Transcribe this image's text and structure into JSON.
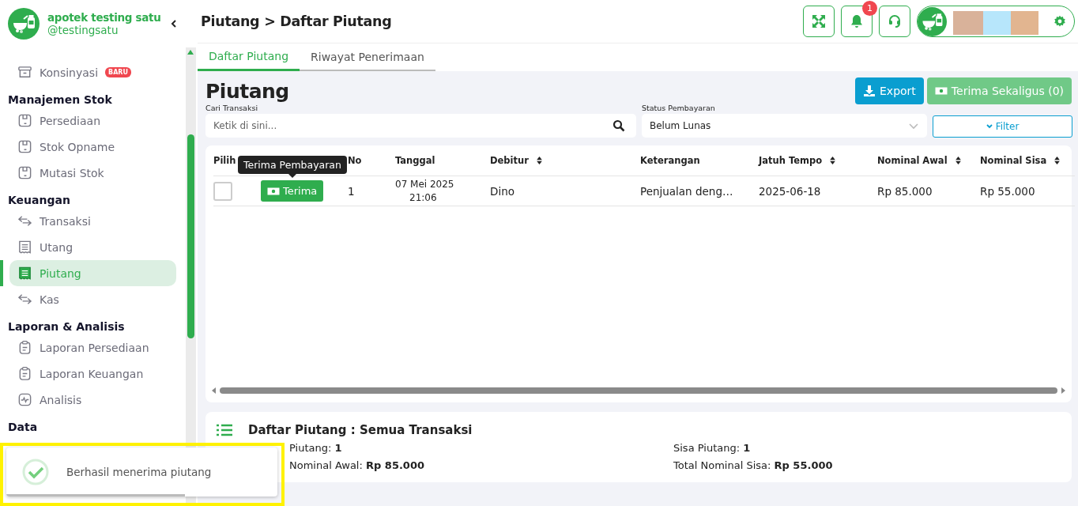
{
  "sidebar": {
    "brand": {
      "name": "apotek testing satu",
      "handle": "@testingsatu"
    },
    "top_items": [
      {
        "label": "Konsinyasi",
        "kind": "archive",
        "badge": "BARU",
        "selected": false
      }
    ],
    "sections": [
      {
        "title": "Manajemen Stok",
        "items": [
          {
            "label": "Persediaan",
            "kind": "box",
            "selected": false
          },
          {
            "label": "Stok Opname",
            "kind": "box",
            "selected": false
          },
          {
            "label": "Mutasi Stok",
            "kind": "box",
            "selected": false
          }
        ]
      },
      {
        "title": "Keuangan",
        "items": [
          {
            "label": "Transaksi",
            "kind": "transfer",
            "selected": false
          },
          {
            "label": "Utang",
            "kind": "receipt",
            "selected": false
          },
          {
            "label": "Piutang",
            "kind": "receipt",
            "selected": true
          },
          {
            "label": "Kas",
            "kind": "transfer",
            "selected": false
          }
        ]
      },
      {
        "title": "Laporan & Analisis",
        "items": [
          {
            "label": "Laporan Persediaan",
            "kind": "clipboard",
            "selected": false
          },
          {
            "label": "Laporan Keuangan",
            "kind": "clipboard",
            "selected": false
          },
          {
            "label": "Analisis",
            "kind": "pulse",
            "selected": false
          }
        ]
      },
      {
        "title": "Data"
      }
    ]
  },
  "header": {
    "breadcrumb": "Piutang > Daftar Piutang",
    "notification_count": "1"
  },
  "tabs": [
    {
      "label": "Daftar Piutang",
      "selected": true
    },
    {
      "label": "Riwayat Penerimaan",
      "selected": false
    }
  ],
  "page": {
    "title": "Piutang",
    "export_button": "Export",
    "receive_all_button": {
      "label": "Terima Sekaligus (0)",
      "disabled": true
    }
  },
  "search": {
    "label": "Cari Transaksi",
    "placeholder": "Ketik di sini..."
  },
  "status_filter": {
    "label": "Status Pembayaran",
    "value": "Belum Lunas"
  },
  "filter_button": "Filter",
  "table": {
    "columns": [
      {
        "label": "Pilih"
      },
      {
        "label": "No",
        "sortable": false
      },
      {
        "label": "Tanggal",
        "sortable": false
      },
      {
        "label": "Debitur",
        "sortable": true
      },
      {
        "label": "Keterangan",
        "sortable": false
      },
      {
        "label": "Jatuh Tempo",
        "sortable": true
      },
      {
        "label": "Nominal Awal",
        "sortable": true
      },
      {
        "label": "Nominal Sisa",
        "sortable": true
      }
    ],
    "rows": [
      {
        "checked": false,
        "action": "Terima",
        "no": "1",
        "date": "07 Mei 2025",
        "time": "21:06",
        "debtor": "Dino",
        "description": "Penjualan deng…",
        "due": "2025-06-18",
        "initial": "Rp 85.000",
        "remaining": "Rp 55.000"
      }
    ],
    "tooltip": "Terima Pembayaran"
  },
  "summary": {
    "title": "Daftar Piutang : Semua Transaksi",
    "items": [
      "Piutang: **1**",
      "Sisa Piutang: **1**",
      "Nominal Awal: **Rp 85.000**",
      "Total Nominal Sisa: **Rp 55.000**"
    ]
  },
  "toast": {
    "message": "Berhasil menerima piutang",
    "level": 0.66,
    "highlighted": true
  }
}
